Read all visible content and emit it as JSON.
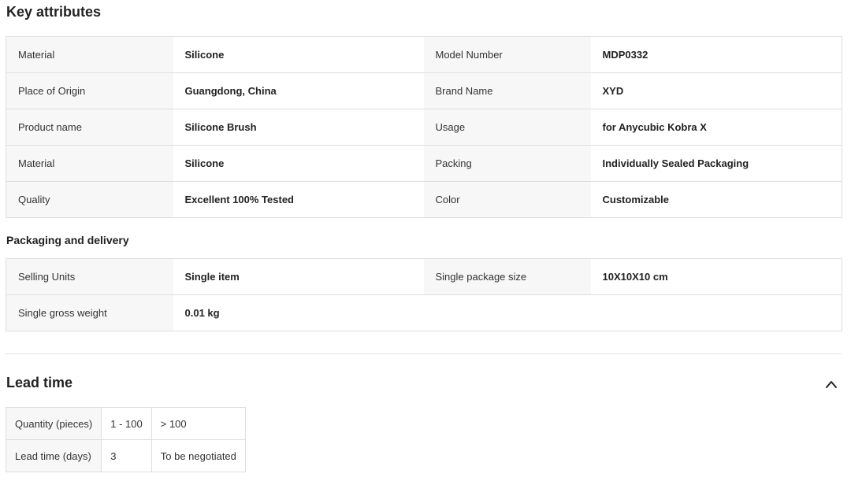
{
  "key_attributes": {
    "title": "Key attributes",
    "rows": [
      {
        "k1": "Material",
        "v1": "Silicone",
        "k2": "Model Number",
        "v2": "MDP0332"
      },
      {
        "k1": "Place of Origin",
        "v1": "Guangdong, China",
        "k2": "Brand Name",
        "v2": "XYD"
      },
      {
        "k1": "Product name",
        "v1": "Silicone Brush",
        "k2": "Usage",
        "v2": "for Anycubic Kobra X"
      },
      {
        "k1": "Material",
        "v1": "Silicone",
        "k2": "Packing",
        "v2": "Individually Sealed Packaging"
      },
      {
        "k1": "Quality",
        "v1": "Excellent 100% Tested",
        "k2": "Color",
        "v2": "Customizable"
      }
    ]
  },
  "packaging": {
    "title": "Packaging and delivery",
    "rows": [
      {
        "k1": "Selling Units",
        "v1": "Single item",
        "k2": "Single package size",
        "v2": "10X10X10 cm"
      },
      {
        "k1": "Single gross weight",
        "v1": "0.01 kg"
      }
    ]
  },
  "lead_time": {
    "title": "Lead time",
    "toggle_icon": "chevron-up-icon",
    "quantity_label": "Quantity (pieces)",
    "quantity_values": [
      "1 - 100",
      "> 100"
    ],
    "days_label": "Lead time (days)",
    "days_values": [
      "3",
      "To be negotiated"
    ]
  }
}
